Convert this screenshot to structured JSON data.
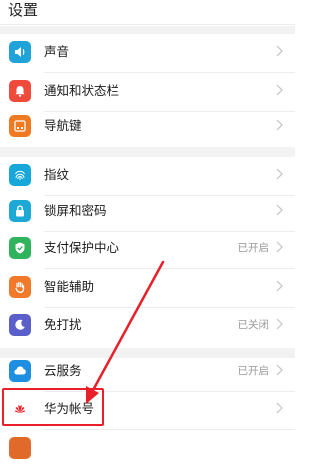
{
  "header": {
    "title": "设置"
  },
  "rows": [
    {
      "label": "声音",
      "status": "",
      "icon": "speaker-icon",
      "color": "#1fa3d8"
    },
    {
      "label": "通知和状态栏",
      "status": "",
      "icon": "bell-icon",
      "color": "#ef4a3c"
    },
    {
      "label": "导航键",
      "status": "",
      "icon": "navigation-key-icon",
      "color": "#f07a22"
    },
    {
      "label": "指纹",
      "status": "",
      "icon": "fingerprint-icon",
      "color": "#17a7d8"
    },
    {
      "label": "锁屏和密码",
      "status": "",
      "icon": "lock-icon",
      "color": "#1ea8d5"
    },
    {
      "label": "支付保护中心",
      "status": "已开启",
      "icon": "shield-check-icon",
      "color": "#2fb35c"
    },
    {
      "label": "智能辅助",
      "status": "",
      "icon": "hand-icon",
      "color": "#f0792a"
    },
    {
      "label": "免打扰",
      "status": "已关闭",
      "icon": "moon-icon",
      "color": "#5b5fc9"
    },
    {
      "label": "云服务",
      "status": "已开启",
      "icon": "cloud-icon",
      "color": "#1e8fe0"
    },
    {
      "label": "华为帐号",
      "status": "",
      "icon": "huawei-logo-icon",
      "color": "#e9232c"
    },
    {
      "label": "",
      "status": "",
      "icon": "app-icon",
      "color": "#e06a2a"
    }
  ],
  "annotation": {
    "color": "#e8202a"
  }
}
